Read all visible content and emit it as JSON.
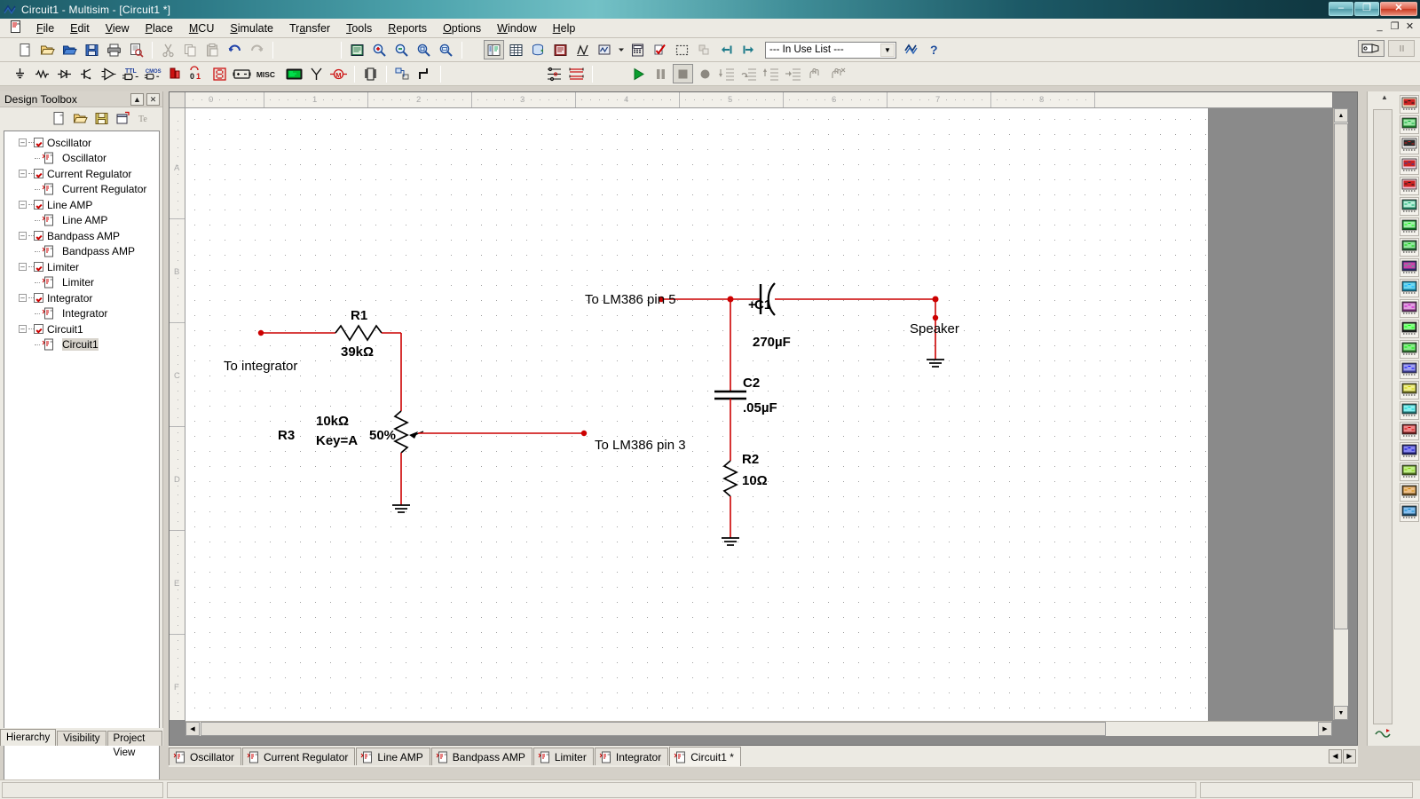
{
  "window": {
    "title": "Circuit1 - Multisim - [Circuit1 *]",
    "app_icon": "multisim-icon",
    "minimize": "–",
    "restore": "❐",
    "close": "✕"
  },
  "mdi_buttons": {
    "minimize": "_",
    "restore": "❐",
    "close": "✕"
  },
  "menu": {
    "items": [
      {
        "label": "File",
        "accel": "F"
      },
      {
        "label": "Edit",
        "accel": "E"
      },
      {
        "label": "View",
        "accel": "V"
      },
      {
        "label": "Place",
        "accel": "P"
      },
      {
        "label": "MCU",
        "accel": "M"
      },
      {
        "label": "Simulate",
        "accel": "S"
      },
      {
        "label": "Transfer",
        "accel": "a"
      },
      {
        "label": "Tools",
        "accel": "T"
      },
      {
        "label": "Reports",
        "accel": "R"
      },
      {
        "label": "Options",
        "accel": "O"
      },
      {
        "label": "Window",
        "accel": "W"
      },
      {
        "label": "Help",
        "accel": "H"
      }
    ]
  },
  "toolbar_main": {
    "buttons": [
      {
        "name": "new-file-icon",
        "title": "New"
      },
      {
        "name": "open-file-icon",
        "title": "Open"
      },
      {
        "name": "open-design-icon",
        "title": "Open Samples"
      },
      {
        "name": "save-icon",
        "title": "Save"
      },
      {
        "name": "print-icon",
        "title": "Print"
      },
      {
        "name": "print-preview-icon",
        "title": "Print Preview"
      },
      {
        "name": "cut-icon",
        "title": "Cut"
      },
      {
        "name": "copy-icon",
        "title": "Copy"
      },
      {
        "name": "paste-icon",
        "title": "Paste"
      },
      {
        "name": "undo-icon",
        "title": "Undo"
      },
      {
        "name": "redo-icon",
        "title": "Redo"
      }
    ],
    "view_buttons": [
      {
        "name": "full-screen-icon",
        "title": "Toggle full screen"
      },
      {
        "name": "zoom-in-icon",
        "title": "Zoom In"
      },
      {
        "name": "zoom-out-icon",
        "title": "Zoom Out"
      },
      {
        "name": "zoom-area-icon",
        "title": "Zoom Area"
      },
      {
        "name": "zoom-fit-icon",
        "title": "Zoom Fit to Page"
      }
    ],
    "design_buttons": [
      {
        "name": "design-toolbox-icon",
        "title": "Toggle Design Toolbox"
      },
      {
        "name": "spreadsheet-view-icon",
        "title": "Toggle Spreadsheet View"
      },
      {
        "name": "database-icon",
        "title": "Database Manager"
      },
      {
        "name": "component-wizard-icon",
        "title": "Create Component"
      },
      {
        "name": "grapher-icon",
        "title": "Grapher/Analyses"
      },
      {
        "name": "analyses-dropdown-icon",
        "title": "Analyses list"
      },
      {
        "name": "postprocessor-icon",
        "title": "Postprocessor"
      },
      {
        "name": "erc-icon",
        "title": "Electrical Rules Check"
      },
      {
        "name": "area-capture-icon",
        "title": "Capture Screen Area"
      },
      {
        "name": "back-annotate-icon",
        "title": "Back annotate"
      },
      {
        "name": "forward-annotate-icon",
        "title": "Forward annotate"
      },
      {
        "name": "transfer-to-ultiboard-icon",
        "title": "Transfer to Ultiboard"
      }
    ],
    "in_use_list": {
      "label": "--- In Use List ---",
      "arrow": "▼"
    },
    "help_buttons": [
      {
        "name": "multisim-help-icon",
        "title": "Multisim Help"
      },
      {
        "name": "help-question-icon",
        "title": "Help"
      }
    ],
    "far_right": [
      {
        "name": "tear-off-icon",
        "title": "Tear-off toolbar"
      },
      {
        "name": "pause-strip-icon",
        "title": "Pause"
      }
    ]
  },
  "toolbar_components": {
    "buttons": [
      {
        "name": "place-source-icon",
        "title": "Place Source"
      },
      {
        "name": "place-basic-icon",
        "title": "Place Basic"
      },
      {
        "name": "place-diode-icon",
        "title": "Place Diode"
      },
      {
        "name": "place-transistor-icon",
        "title": "Place Transistor"
      },
      {
        "name": "place-analog-icon",
        "title": "Place Analog"
      },
      {
        "name": "place-ttl-icon",
        "title": "Place TTL"
      },
      {
        "name": "place-cmos-icon",
        "title": "Place CMOS"
      },
      {
        "name": "place-misc-digital-icon",
        "title": "Place Misc Digital"
      },
      {
        "name": "place-mixed-icon",
        "title": "Place Mixed"
      },
      {
        "name": "place-indicator-icon",
        "title": "Place Indicator"
      },
      {
        "name": "place-power-icon",
        "title": "Place Power Component"
      },
      {
        "name": "place-misc-icon",
        "title": "Place Misc"
      },
      {
        "name": "place-advanced-peripherals-icon",
        "title": "Place Advanced Peripherals"
      },
      {
        "name": "place-rf-icon",
        "title": "Place RF"
      },
      {
        "name": "place-electromechanical-icon",
        "title": "Place Electromechanical"
      },
      {
        "name": "place-mcu-icon",
        "title": "Place MCU"
      },
      {
        "name": "place-hierarchical-block-icon",
        "title": "Place Hierarchical Block"
      },
      {
        "name": "place-bus-icon",
        "title": "Place Bus"
      }
    ],
    "view_buttons": [
      {
        "name": "grapher-view-icon",
        "title": "Grapher"
      },
      {
        "name": "list-view-icon",
        "title": "List"
      }
    ],
    "sim_buttons": [
      {
        "name": "run-icon",
        "title": "Run"
      },
      {
        "name": "pause-icon",
        "title": "Pause"
      },
      {
        "name": "stop-icon",
        "title": "Stop"
      },
      {
        "name": "record-icon",
        "title": "Record"
      },
      {
        "name": "step-into-icon",
        "title": "Step into"
      },
      {
        "name": "step-over-icon",
        "title": "Step over"
      },
      {
        "name": "step-out-icon",
        "title": "Step out"
      },
      {
        "name": "run-to-cursor-icon",
        "title": "Run to cursor"
      },
      {
        "name": "pause-at-icon",
        "title": "Pause at"
      },
      {
        "name": "toggle-breakpoint-icon",
        "title": "Toggle breakpoint"
      }
    ]
  },
  "design_toolbox": {
    "title": "Design Toolbox",
    "collapse_button": "▲",
    "close_button": "✕",
    "toolbar_icons": [
      {
        "name": "new-project-icon"
      },
      {
        "name": "open-project-icon"
      },
      {
        "name": "save-project-icon"
      },
      {
        "name": "close-project-icon"
      },
      {
        "name": "text-icon"
      }
    ],
    "tree": [
      {
        "label": "Oscillator",
        "checked": true,
        "children": [
          {
            "label": "Oscillator"
          }
        ]
      },
      {
        "label": "Current Regulator",
        "checked": true,
        "children": [
          {
            "label": "Current Regulator"
          }
        ]
      },
      {
        "label": "Line AMP",
        "checked": true,
        "children": [
          {
            "label": "Line AMP"
          }
        ]
      },
      {
        "label": "Bandpass AMP",
        "checked": true,
        "children": [
          {
            "label": "Bandpass AMP"
          }
        ]
      },
      {
        "label": "Limiter",
        "checked": true,
        "children": [
          {
            "label": "Limiter"
          }
        ]
      },
      {
        "label": "Integrator",
        "checked": true,
        "children": [
          {
            "label": "Integrator"
          }
        ]
      },
      {
        "label": "Circuit1",
        "checked": true,
        "children": [
          {
            "label": "Circuit1",
            "selected": true
          }
        ]
      }
    ],
    "tabs": [
      {
        "label": "Hierarchy",
        "active": true
      },
      {
        "label": "Visibility",
        "active": false
      },
      {
        "label": "Project View",
        "active": false
      }
    ]
  },
  "sheet_tabs": [
    {
      "label": "Oscillator",
      "active": false
    },
    {
      "label": "Current Regulator",
      "active": false
    },
    {
      "label": "Line AMP",
      "active": false
    },
    {
      "label": "Bandpass AMP",
      "active": false
    },
    {
      "label": "Limiter",
      "active": false
    },
    {
      "label": "Integrator",
      "active": false
    },
    {
      "label": "Circuit1 *",
      "active": true
    }
  ],
  "sheet_tab_nav": {
    "prev": "◀",
    "next": "▶"
  },
  "rulers": {
    "horizontal": [
      "0",
      "1",
      "2",
      "3",
      "4",
      "5",
      "6",
      "7",
      "8"
    ],
    "vertical": [
      "A",
      "B",
      "C",
      "D",
      "E",
      "F"
    ]
  },
  "schematic": {
    "labels": {
      "to_integrator": "To integrator",
      "to_lm386_pin5": "To LM386 pin 5",
      "to_lm386_pin3": "To LM386 pin 3",
      "speaker": "Speaker"
    },
    "components": [
      {
        "ref": "R1",
        "value": "39kΩ",
        "type": "resistor"
      },
      {
        "ref": "R2",
        "value": "10Ω",
        "type": "resistor"
      },
      {
        "ref": "R3",
        "value": "10kΩ",
        "extra": "Key=A",
        "setting": "50%",
        "type": "potentiometer"
      },
      {
        "ref": "C1",
        "value": "270µF",
        "polarity": "+",
        "type": "capacitor-polarized"
      },
      {
        "ref": "C2",
        "value": ".05µF",
        "type": "capacitor"
      }
    ]
  },
  "instruments": {
    "collapse": "▲",
    "items": [
      {
        "name": "multimeter-icon"
      },
      {
        "name": "function-generator-icon"
      },
      {
        "name": "wattmeter-icon"
      },
      {
        "name": "oscilloscope-icon"
      },
      {
        "name": "four-channel-oscilloscope-icon"
      },
      {
        "name": "bode-plotter-icon"
      },
      {
        "name": "frequency-counter-icon"
      },
      {
        "name": "word-generator-icon"
      },
      {
        "name": "logic-analyzer-icon"
      },
      {
        "name": "logic-converter-icon"
      },
      {
        "name": "iv-analyzer-icon"
      },
      {
        "name": "distortion-analyzer-icon"
      },
      {
        "name": "spectrum-analyzer-icon"
      },
      {
        "name": "network-analyzer-icon"
      },
      {
        "name": "agilent-function-generator-icon"
      },
      {
        "name": "agilent-multimeter-icon"
      },
      {
        "name": "agilent-oscilloscope-icon"
      },
      {
        "name": "tektronix-oscilloscope-icon"
      },
      {
        "name": "labview-instruments-icon"
      },
      {
        "name": "measurement-probe-icon"
      },
      {
        "name": "current-clamp-icon"
      }
    ]
  },
  "colors": {
    "wire": "#cc0000",
    "component": "#000000",
    "canvas": "#ffffff",
    "grid_dot": "#9f9f9f",
    "chrome": "#eceae3",
    "title_gradient_start": "#1d5a66",
    "title_gradient_mid": "#73c1c6"
  }
}
